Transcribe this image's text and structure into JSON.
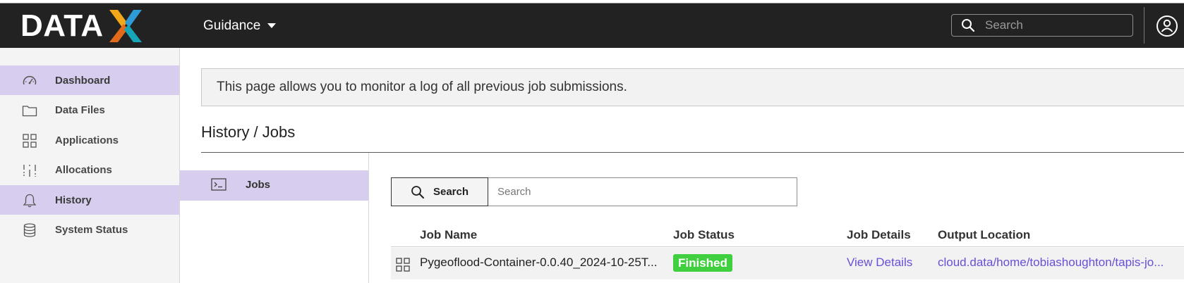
{
  "header": {
    "logo_text": "DATA",
    "menu_label": "Guidance",
    "search_placeholder": "Search",
    "logo_colors": [
      "#f2a818",
      "#2e9ad6",
      "#e26a1b",
      "#16a6b8"
    ]
  },
  "sidebar": {
    "items": [
      {
        "label": "Dashboard",
        "icon": "dashboard-gauge-icon",
        "active": true
      },
      {
        "label": "Data Files",
        "icon": "folder-icon",
        "active": false
      },
      {
        "label": "Applications",
        "icon": "grid-icon",
        "active": false
      },
      {
        "label": "Allocations",
        "icon": "allocation-bars-icon",
        "active": false
      },
      {
        "label": "History",
        "icon": "bell-icon",
        "active": true
      },
      {
        "label": "System Status",
        "icon": "database-icon",
        "active": false
      }
    ]
  },
  "main": {
    "notice": "This page allows you to monitor a log of all previous job submissions.",
    "breadcrumb": "History / Jobs",
    "subnav": {
      "label": "Jobs",
      "icon": "terminal-icon"
    },
    "search": {
      "button_label": "Search",
      "placeholder": "Search"
    },
    "table": {
      "columns": [
        "Job Name",
        "Job Status",
        "Job Details",
        "Output Location"
      ],
      "rows": [
        {
          "job_name": "Pygeoflood-Container-0.0.40_2024-10-25T...",
          "job_status": "Finished",
          "job_details": "View Details",
          "output_location": "cloud.data/home/tobiashoughton/tapis-jo..."
        }
      ]
    }
  },
  "colors": {
    "topbar": "#222222",
    "active_nav": "#d7cdee",
    "status_finished": "#3fcf3f",
    "link": "#6a4fd6"
  }
}
